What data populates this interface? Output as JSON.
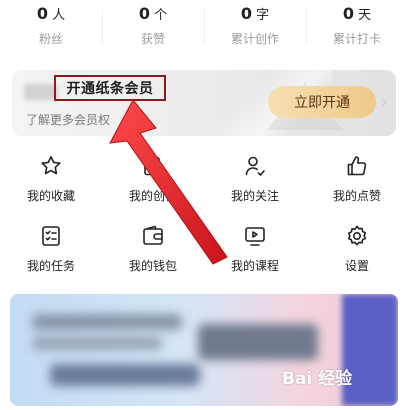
{
  "stats": [
    {
      "value": "0",
      "unit": "人",
      "label": "粉丝"
    },
    {
      "value": "0",
      "unit": "个",
      "label": "获赞"
    },
    {
      "value": "0",
      "unit": "字",
      "label": "累计创作"
    },
    {
      "value": "0",
      "unit": "天",
      "label": "累计打卡"
    }
  ],
  "vip": {
    "title": "开通纸条会员",
    "subtitle": "了解更多会员权",
    "button": "立即开通"
  },
  "grid": [
    {
      "label": "我的收藏",
      "icon": "star-icon"
    },
    {
      "label": "我的创作",
      "icon": "pen-icon"
    },
    {
      "label": "我的关注",
      "icon": "follow-user-icon"
    },
    {
      "label": "我的点赞",
      "icon": "thumbs-up-icon"
    },
    {
      "label": "我的任务",
      "icon": "task-list-icon"
    },
    {
      "label": "我的钱包",
      "icon": "wallet-icon"
    },
    {
      "label": "我的课程",
      "icon": "course-video-icon"
    },
    {
      "label": "设置",
      "icon": "gear-icon"
    }
  ],
  "watermark": "Bai 经验",
  "colors": {
    "annotation_red": "#e0242b",
    "highlight_border": "#8b1a1a",
    "vip_button": "#efc98a"
  }
}
